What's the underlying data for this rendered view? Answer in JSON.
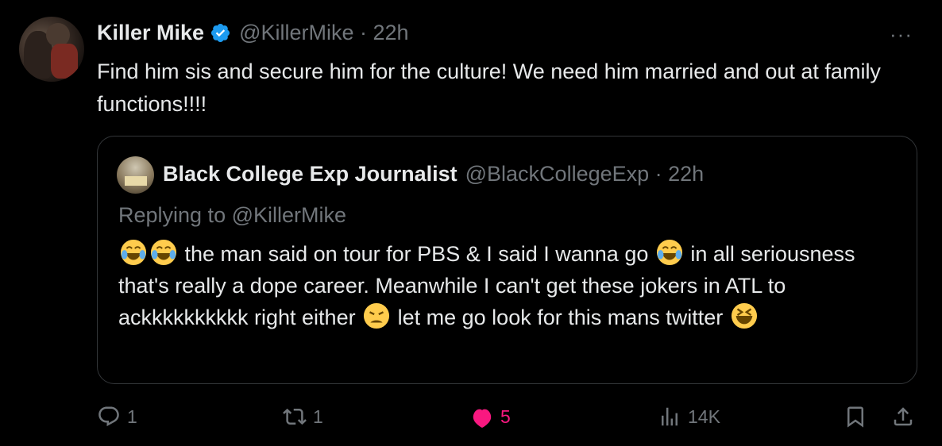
{
  "tweet": {
    "author_name": "Killer Mike",
    "handle_time": "@KillerMike · 22h",
    "more": "···",
    "text": "Find him sis and secure him for the culture!  We need him married and out at family functions!!!!"
  },
  "quote": {
    "author_name": "Black College Exp Journalist",
    "handle_time": "@BlackCollegeExp · 22h",
    "replying": "Replying to @KillerMike",
    "text_1": "the man said on tour for PBS & I said I wanna go",
    "text_2": "in all seriousness that's really a dope career. Meanwhile I can't get these jokers in ATL to ackkkkkkkkkk right either",
    "text_3": "let me go look for this mans twitter"
  },
  "actions": {
    "replies": "1",
    "reposts": "1",
    "likes": "5",
    "views": "14K"
  },
  "colors": {
    "background": "#000000",
    "text": "#e7e9ea",
    "muted": "#71767b",
    "verified": "#1d9bf0",
    "like": "#f91880"
  },
  "icons": [
    "verified-badge-icon",
    "more-icon",
    "reply-icon",
    "repost-icon",
    "like-icon",
    "views-icon",
    "bookmark-icon",
    "share-icon",
    "joy-emoji",
    "weary-emoji",
    "laughing-emoji"
  ]
}
